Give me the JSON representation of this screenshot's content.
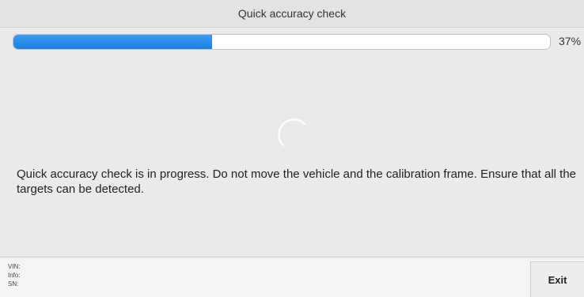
{
  "window": {
    "title": "Quick accuracy check"
  },
  "progress": {
    "percent_label": "37%",
    "fraction": 0.37,
    "fill_color": "#2a8ae8"
  },
  "spinner": {
    "icon": "loading-spinner-icon"
  },
  "main": {
    "message": "Quick accuracy check is in progress. Do not move the vehicle and the calibration frame. Ensure that all the targets can be detected."
  },
  "footer": {
    "vin_label": "VIN:",
    "info_label": "Info:",
    "sn_label": "SN:",
    "exit_label": "Exit"
  }
}
